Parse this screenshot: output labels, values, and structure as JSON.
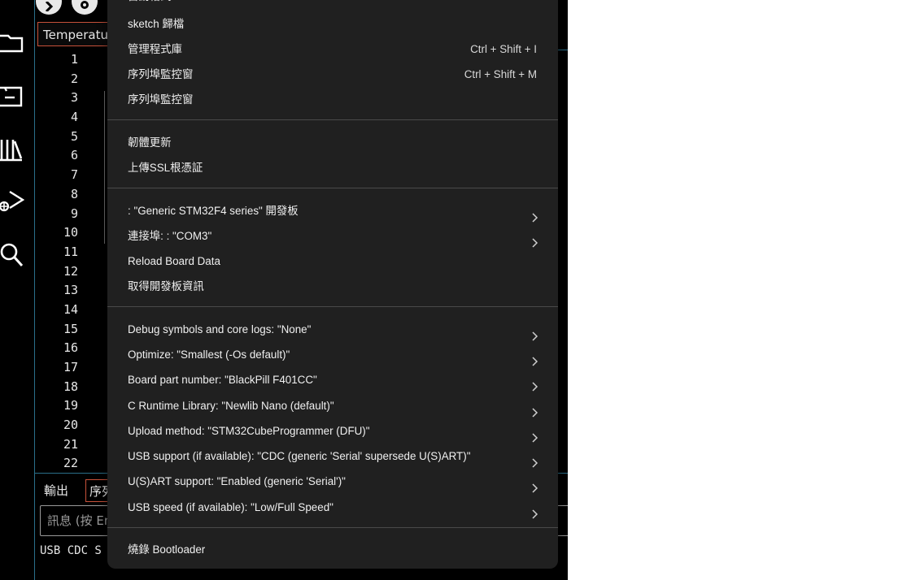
{
  "editor": {
    "tab_label": "Temperature",
    "line_numbers": [
      "1",
      "2",
      "3",
      "4",
      "5",
      "6",
      "7",
      "8",
      "9",
      "10",
      "11",
      "12",
      "13",
      "14",
      "15",
      "16",
      "17",
      "18",
      "19",
      "20",
      "21",
      "22"
    ]
  },
  "panel": {
    "tab_output": "輸出",
    "tab_serial": "序列",
    "message_placeholder": "訊息 (按 Enter",
    "output_text": "USB CDC S"
  },
  "menu": {
    "items": [
      {
        "label": "自動格式",
        "shortcut": "Ctrl + T"
      },
      {
        "label": "sketch 歸檔",
        "shortcut": ""
      },
      {
        "label": "管理程式庫",
        "shortcut": "Ctrl + Shift + I"
      },
      {
        "label": "序列埠監控窗",
        "shortcut": "Ctrl + Shift + M"
      },
      {
        "label": "序列埠監控窗",
        "shortcut": ""
      },
      {
        "label": "韌體更新",
        "shortcut": ""
      },
      {
        "label": "上傳SSL根憑証",
        "shortcut": ""
      },
      {
        "label": ": \"Generic STM32F4 series\" 開發板",
        "submenu": true
      },
      {
        "label": "連接埠: : \"COM3\"",
        "submenu": true
      },
      {
        "label": "Reload Board Data",
        "shortcut": ""
      },
      {
        "label": "取得開發板資訊",
        "shortcut": ""
      },
      {
        "label": "Debug symbols and core logs: \"None\"",
        "submenu": true
      },
      {
        "label": "Optimize: \"Smallest (-Os default)\"",
        "submenu": true
      },
      {
        "label": "Board part number: \"BlackPill F401CC\"",
        "submenu": true
      },
      {
        "label": "C Runtime Library: \"Newlib Nano (default)\"",
        "submenu": true
      },
      {
        "label": "Upload method: \"STM32CubeProgrammer (DFU)\"",
        "submenu": true
      },
      {
        "label": "USB support (if available): \"CDC (generic 'Serial' supersede U(S)ART)\"",
        "submenu": true
      },
      {
        "label": "U(S)ART support: \"Enabled (generic 'Serial')\"",
        "submenu": true
      },
      {
        "label": "USB speed (if available): \"Low/Full Speed\"",
        "submenu": true
      },
      {
        "label": "燒錄 Bootloader",
        "shortcut": ""
      }
    ]
  },
  "icons": {
    "activity": [
      "folder-icon",
      "board-icon",
      "library-icon",
      "debug-icon",
      "search-icon"
    ],
    "toolbar": [
      "verify-icon",
      "upload-icon",
      "debugger-icon"
    ]
  }
}
